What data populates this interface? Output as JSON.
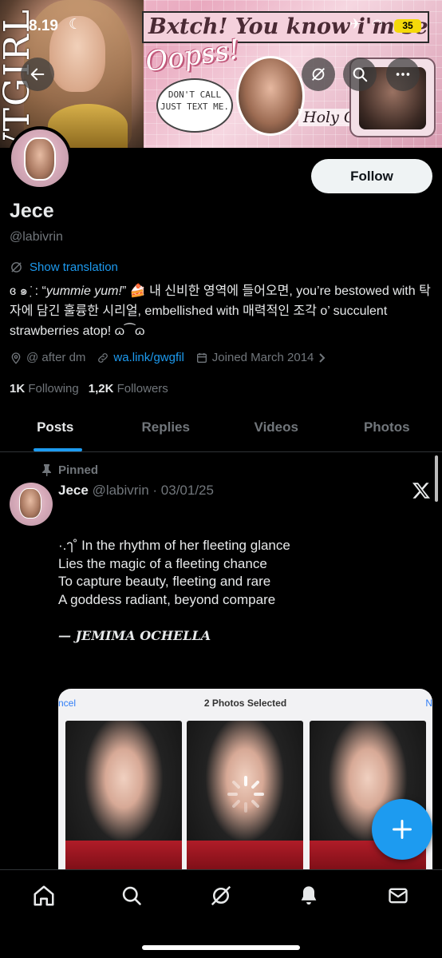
{
  "status_bar": {
    "time": "8.19",
    "battery": "35"
  },
  "banner": {
    "vertical_text": "VTGIRL",
    "headline": "Bxtch! You know i'm se...",
    "oopss": "Oopss!",
    "bubble": "DON'T CALL JUST TEXT ME.",
    "holy_god": "Holy God"
  },
  "profile": {
    "follow_label": "Follow",
    "display_name": "Jece",
    "handle": "@labivrin",
    "show_translation": "Show translation",
    "bio_prefix": "ɞ ๑ ̇ ̣: “",
    "bio_italic": "yummie yum!",
    "bio_rest": "” 🍰 내 신비한 영역에 들어오면, you’re bestowed with 탁자에 담긴 훌륭한 시리얼, embellished with 매력적인 조각 o’ succulent strawberries atop! ɷ⁀ɷ",
    "location": "@ after dm",
    "link": "wa.link/gwgfil",
    "joined": "Joined March 2014",
    "following_count": "1K",
    "following_label": "Following",
    "followers_count": "1,2K",
    "followers_label": "Followers"
  },
  "tabs": [
    {
      "label": "Posts",
      "active": true
    },
    {
      "label": "Replies",
      "active": false
    },
    {
      "label": "Videos",
      "active": false
    },
    {
      "label": "Photos",
      "active": false
    }
  ],
  "post": {
    "pinned_label": "Pinned",
    "author_name": "Jece",
    "author_meta": "@labivrin · 03/01/25",
    "text": "·.ๅ˚ In the rhythm of her fleeting glance\nLies the magic of a fleeting chance\nTo capture beauty, fleeting and rare\nA goddess radiant, beyond compare",
    "signature": "— JEMIMA OCHELLA",
    "media": {
      "cancel": "ncel",
      "title": "2 Photos Selected",
      "next": "N"
    }
  },
  "icons": {
    "back": "arrow-left-icon",
    "grok": "grok-icon",
    "search": "search-icon",
    "more": "more-icon",
    "translate": "translate-icon",
    "location": "location-pin-icon",
    "link": "link-icon",
    "calendar": "calendar-icon",
    "pin": "pin-icon",
    "x_logo": "x-logo-icon",
    "compose": "plus-icon",
    "nav_home": "home-icon",
    "nav_search": "search-icon",
    "nav_grok": "grok-icon",
    "nav_notifications": "bell-icon",
    "nav_messages": "mail-icon"
  },
  "colors": {
    "accent": "#1d9bf0",
    "background": "#000000",
    "text": "#e7e9ea",
    "muted": "#71767b"
  }
}
